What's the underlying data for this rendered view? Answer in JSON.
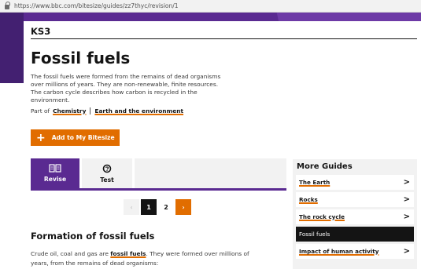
{
  "browser": {
    "url": "https://www.bbc.com/bitesize/guides/zz7thyc/revision/1"
  },
  "level": "KS3",
  "page_title": "Fossil fuels",
  "description": "The fossil fuels were formed from the remains of dead organisms over millions of years. They are non-renewable, finite resources. The carbon cycle describes how carbon is recycled in the environment.",
  "part_of": {
    "prefix": "Part of",
    "links": [
      "Chemistry",
      "Earth and the environment"
    ]
  },
  "add_button": {
    "icon": "plus-icon",
    "label": "Add to My Bitesize"
  },
  "tabs": [
    {
      "label": "Revise",
      "icon": "book-icon",
      "active": true
    },
    {
      "label": "Test",
      "icon": "test-icon",
      "active": false
    }
  ],
  "pagination": {
    "prev": "‹",
    "pages": [
      "1",
      "2"
    ],
    "current": "1",
    "next": "›"
  },
  "section": {
    "heading": "Formation of fossil fuels",
    "text_before": "Crude oil, coal and gas are ",
    "link": "fossil fuels",
    "text_after": ". They were formed over millions of years, from the remains of dead organisms:"
  },
  "more_guides": {
    "title": "More Guides",
    "items": [
      {
        "label": "The Earth",
        "active": false
      },
      {
        "label": "Rocks",
        "active": false
      },
      {
        "label": "The rock cycle",
        "active": false
      },
      {
        "label": "Fossil fuels",
        "active": true
      },
      {
        "label": "Impact of human activity",
        "active": false
      }
    ]
  },
  "colors": {
    "brand_purple": "#5a2a91",
    "accent_orange": "#e16d00",
    "dark": "#141414",
    "panel": "#f2f2f2"
  }
}
